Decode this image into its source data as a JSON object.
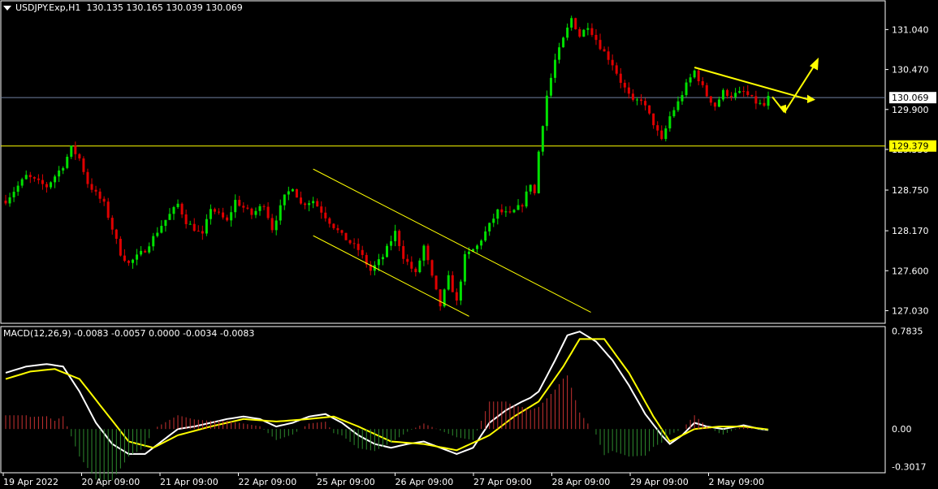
{
  "header": {
    "symbol": "USDJPY.Exp,H1",
    "ohlc": "130.135 130.165 130.039 130.069"
  },
  "macd_header": {
    "label": "MACD(12,26,9)",
    "values": "-0.0083 -0.0057 0.0000 -0.0034 -0.0083"
  },
  "colors": {
    "background": "#000000",
    "bull": "#00e000",
    "bear": "#e00000",
    "grid_frame": "#ffffff",
    "trendline": "#ffff00",
    "macd_line": "#ffffff",
    "signal_line": "#ffff00",
    "hist_pos": "#c83232",
    "hist_neg": "#2e8b2e"
  },
  "chart_data": [
    {
      "type": "candlestick",
      "symbol": "USDJPY.Exp",
      "timeframe": "H1",
      "ylim": [
        126.85,
        131.45
      ],
      "y_ticks": [
        131.04,
        130.47,
        129.9,
        129.33,
        128.75,
        128.17,
        127.6,
        127.03
      ],
      "x_ticks": [
        "19 Apr 2022",
        "20 Apr 09:00",
        "21 Apr 09:00",
        "22 Apr 09:00",
        "25 Apr 09:00",
        "26 Apr 09:00",
        "27 Apr 09:00",
        "28 Apr 09:00",
        "29 Apr 09:00",
        "2 May 09:00"
      ],
      "current_price": 130.069,
      "horizontal_level": 129.379,
      "price_path": [
        [
          0,
          128.6
        ],
        [
          5,
          128.95
        ],
        [
          10,
          128.8
        ],
        [
          14,
          129.1
        ],
        [
          16,
          129.35
        ],
        [
          18,
          129.2
        ],
        [
          20,
          128.85
        ],
        [
          24,
          128.55
        ],
        [
          28,
          127.85
        ],
        [
          30,
          127.7
        ],
        [
          34,
          127.9
        ],
        [
          38,
          128.25
        ],
        [
          42,
          128.55
        ],
        [
          44,
          128.3
        ],
        [
          48,
          128.1
        ],
        [
          50,
          128.5
        ],
        [
          54,
          128.3
        ],
        [
          56,
          128.6
        ],
        [
          60,
          128.4
        ],
        [
          63,
          128.55
        ],
        [
          65,
          128.2
        ],
        [
          68,
          128.65
        ],
        [
          70,
          128.8
        ],
        [
          72,
          128.55
        ],
        [
          75,
          128.6
        ],
        [
          79,
          128.3
        ],
        [
          82,
          128.1
        ],
        [
          86,
          127.9
        ],
        [
          89,
          127.6
        ],
        [
          92,
          127.8
        ],
        [
          95,
          128.15
        ],
        [
          97,
          127.8
        ],
        [
          100,
          127.55
        ],
        [
          102,
          127.95
        ],
        [
          104,
          127.5
        ],
        [
          106,
          127.1
        ],
        [
          108,
          127.5
        ],
        [
          110,
          127.15
        ],
        [
          112,
          127.8
        ],
        [
          115,
          127.95
        ],
        [
          118,
          128.25
        ],
        [
          120,
          128.45
        ],
        [
          123,
          128.4
        ],
        [
          126,
          128.55
        ],
        [
          128,
          128.85
        ],
        [
          129,
          128.7
        ],
        [
          130,
          129.3
        ],
        [
          131,
          129.7
        ],
        [
          132,
          130.1
        ],
        [
          134,
          130.6
        ],
        [
          136,
          130.9
        ],
        [
          138,
          131.2
        ],
        [
          140,
          130.95
        ],
        [
          142,
          131.1
        ],
        [
          145,
          130.8
        ],
        [
          148,
          130.55
        ],
        [
          150,
          130.3
        ],
        [
          153,
          130.0
        ],
        [
          155,
          130.05
        ],
        [
          158,
          129.7
        ],
        [
          160,
          129.45
        ],
        [
          162,
          129.8
        ],
        [
          164,
          130.0
        ],
        [
          166,
          130.25
        ],
        [
          168,
          130.45
        ],
        [
          171,
          130.1
        ],
        [
          173,
          129.95
        ],
        [
          175,
          130.15
        ],
        [
          177,
          130.1
        ],
        [
          180,
          130.15
        ],
        [
          183,
          130.0
        ],
        [
          185,
          129.95
        ],
        [
          186,
          130.069
        ]
      ],
      "annotations": [
        {
          "kind": "descending-channel",
          "from_index": 75,
          "to_index": 115
        },
        {
          "kind": "converging-trendlines",
          "from_index": 168,
          "to_index": 186
        },
        {
          "kind": "scenario-arrows",
          "targets": [
            "up",
            "down"
          ]
        }
      ]
    },
    {
      "type": "line+histogram",
      "name": "MACD(12,26,9)",
      "ylim": [
        -0.35,
        0.82
      ],
      "y_ticks": [
        0.7835,
        0.0,
        -0.3017
      ],
      "macd_path": [
        [
          0,
          0.45
        ],
        [
          5,
          0.5
        ],
        [
          10,
          0.52
        ],
        [
          14,
          0.5
        ],
        [
          18,
          0.3
        ],
        [
          22,
          0.05
        ],
        [
          26,
          -0.12
        ],
        [
          30,
          -0.2
        ],
        [
          34,
          -0.2
        ],
        [
          38,
          -0.1
        ],
        [
          42,
          0.0
        ],
        [
          46,
          0.02
        ],
        [
          50,
          0.05
        ],
        [
          54,
          0.08
        ],
        [
          58,
          0.1
        ],
        [
          62,
          0.08
        ],
        [
          66,
          0.02
        ],
        [
          70,
          0.05
        ],
        [
          74,
          0.1
        ],
        [
          78,
          0.12
        ],
        [
          82,
          0.05
        ],
        [
          86,
          -0.05
        ],
        [
          90,
          -0.12
        ],
        [
          94,
          -0.15
        ],
        [
          98,
          -0.12
        ],
        [
          102,
          -0.1
        ],
        [
          106,
          -0.15
        ],
        [
          110,
          -0.2
        ],
        [
          114,
          -0.15
        ],
        [
          118,
          0.05
        ],
        [
          122,
          0.15
        ],
        [
          126,
          0.22
        ],
        [
          128,
          0.25
        ],
        [
          130,
          0.3
        ],
        [
          134,
          0.55
        ],
        [
          137,
          0.75
        ],
        [
          140,
          0.78
        ],
        [
          144,
          0.7
        ],
        [
          148,
          0.55
        ],
        [
          152,
          0.35
        ],
        [
          156,
          0.12
        ],
        [
          160,
          -0.05
        ],
        [
          162,
          -0.12
        ],
        [
          165,
          -0.05
        ],
        [
          168,
          0.05
        ],
        [
          171,
          0.02
        ],
        [
          175,
          0.0
        ],
        [
          180,
          0.03
        ],
        [
          184,
          0.0
        ],
        [
          186,
          -0.0083
        ]
      ],
      "signal_path": [
        [
          0,
          0.4
        ],
        [
          6,
          0.46
        ],
        [
          12,
          0.48
        ],
        [
          18,
          0.4
        ],
        [
          24,
          0.15
        ],
        [
          30,
          -0.1
        ],
        [
          36,
          -0.15
        ],
        [
          42,
          -0.05
        ],
        [
          50,
          0.02
        ],
        [
          58,
          0.08
        ],
        [
          66,
          0.06
        ],
        [
          74,
          0.08
        ],
        [
          80,
          0.1
        ],
        [
          86,
          0.02
        ],
        [
          94,
          -0.1
        ],
        [
          102,
          -0.12
        ],
        [
          110,
          -0.17
        ],
        [
          118,
          -0.05
        ],
        [
          124,
          0.1
        ],
        [
          130,
          0.22
        ],
        [
          136,
          0.5
        ],
        [
          140,
          0.72
        ],
        [
          146,
          0.72
        ],
        [
          152,
          0.45
        ],
        [
          158,
          0.1
        ],
        [
          162,
          -0.1
        ],
        [
          168,
          0.0
        ],
        [
          174,
          0.02
        ],
        [
          180,
          0.02
        ],
        [
          186,
          -0.0034
        ]
      ]
    }
  ]
}
